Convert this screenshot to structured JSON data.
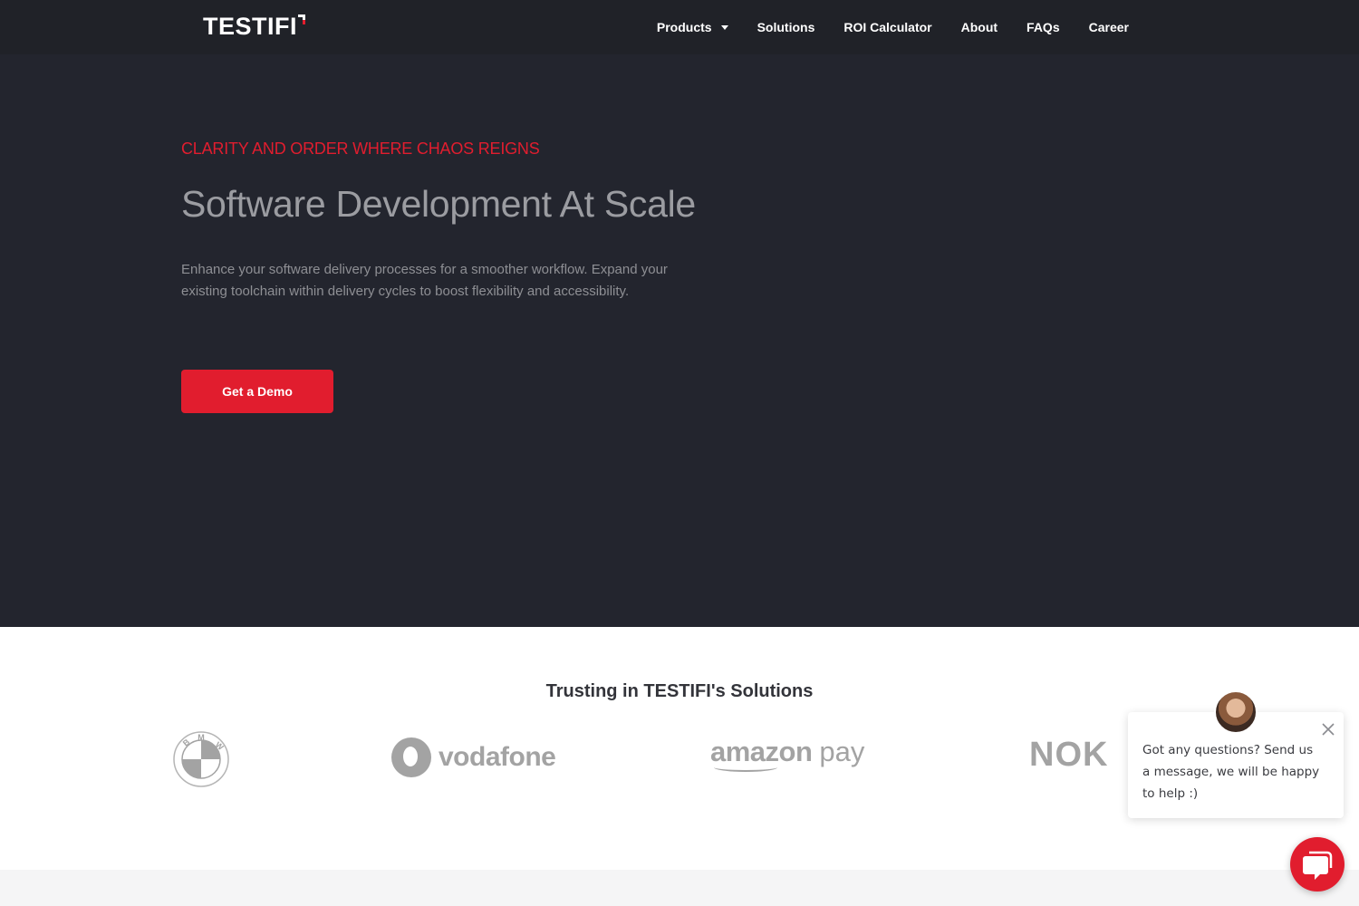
{
  "header": {
    "logo_text": "TESTIFI",
    "nav": [
      {
        "label": "Products",
        "has_dropdown": true
      },
      {
        "label": "Solutions"
      },
      {
        "label": "ROI Calculator"
      },
      {
        "label": "About"
      },
      {
        "label": "FAQs"
      },
      {
        "label": "Career"
      }
    ]
  },
  "hero": {
    "eyebrow": "CLARITY AND ORDER WHERE CHAOS REIGNS",
    "title": "Software Development At Scale",
    "description": "Enhance your software delivery processes for a smoother workflow. Expand your existing toolchain within delivery cycles to boost flexibility and accessibility.",
    "cta_label": "Get a Demo"
  },
  "trust": {
    "title": "Trusting in TESTIFI's Solutions",
    "logos": [
      {
        "name": "bmw-logo",
        "text": "BMW"
      },
      {
        "name": "vodafone-logo",
        "text": "vodafone"
      },
      {
        "name": "amazon-pay-logo",
        "text_a": "amazon",
        "text_b": "pay"
      },
      {
        "name": "nokia-logo",
        "text": "NOK"
      }
    ]
  },
  "chat": {
    "message": "Got any questions? Send us a message, we will be happy to help :)"
  },
  "colors": {
    "accent": "#e11d2e",
    "nav_bg": "#202228",
    "hero_bg": "#23252e"
  }
}
